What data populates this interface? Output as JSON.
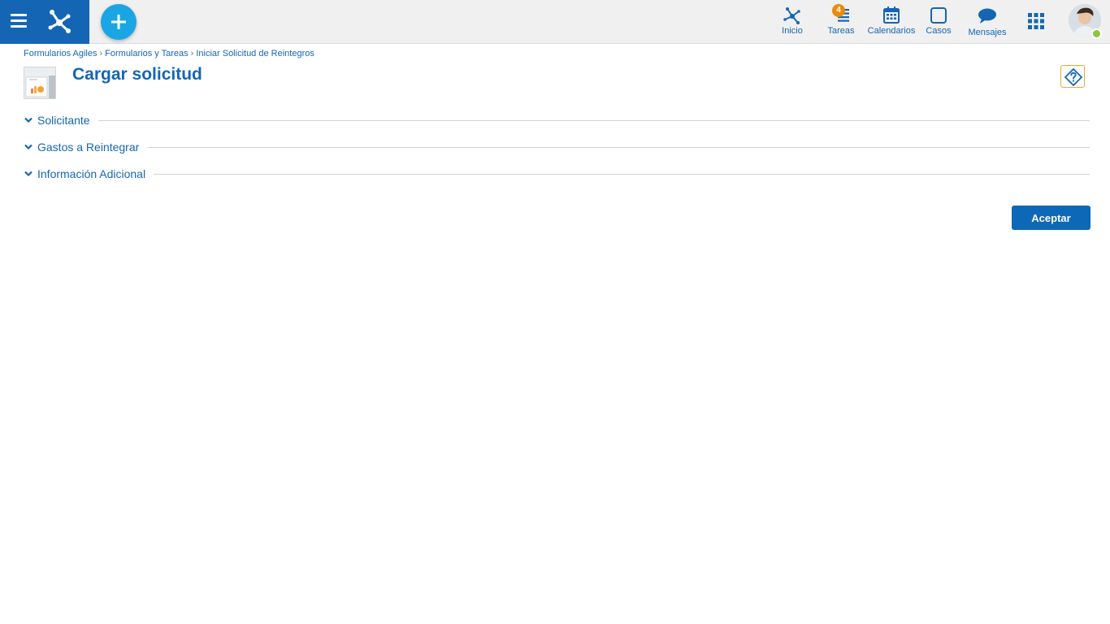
{
  "topbar": {
    "menu_icon": "hamburger-menu-icon",
    "logo_icon": "brand-logo-icon",
    "new_button_icon": "plus-icon",
    "nav": [
      {
        "id": "inicio",
        "label": "Inicio",
        "icon": "home-network-icon"
      },
      {
        "id": "tareas",
        "label": "Tareas",
        "icon": "tasks-list-icon",
        "badge": "4"
      },
      {
        "id": "calendarios",
        "label": "Calendarios",
        "icon": "calendar-icon"
      },
      {
        "id": "casos",
        "label": "Casos",
        "icon": "case-square-icon"
      },
      {
        "id": "mensajes",
        "label": "Mensajes",
        "icon": "chat-bubble-icon"
      }
    ],
    "apps_icon": "apps-grid-icon",
    "avatar": "user-avatar",
    "status": "online"
  },
  "breadcrumb": {
    "items": [
      "Formularios Agiles",
      "Formularios y Tareas",
      "Iniciar Solicitud de Reintegros"
    ],
    "separator": "›"
  },
  "page": {
    "title": "Cargar solicitud",
    "help_icon": "help-diamond-icon"
  },
  "sections": [
    {
      "title": "Solicitante"
    },
    {
      "title": "Gastos a Reintegrar"
    },
    {
      "title": "Información Adicional"
    }
  ],
  "actions": {
    "accept_label": "Aceptar"
  },
  "colors": {
    "brand": "#1466b4",
    "new_button": "#1aa6e4",
    "badge": "#ea8b0c",
    "status_online": "#8cc63f",
    "help_border": "#e8a93a"
  }
}
